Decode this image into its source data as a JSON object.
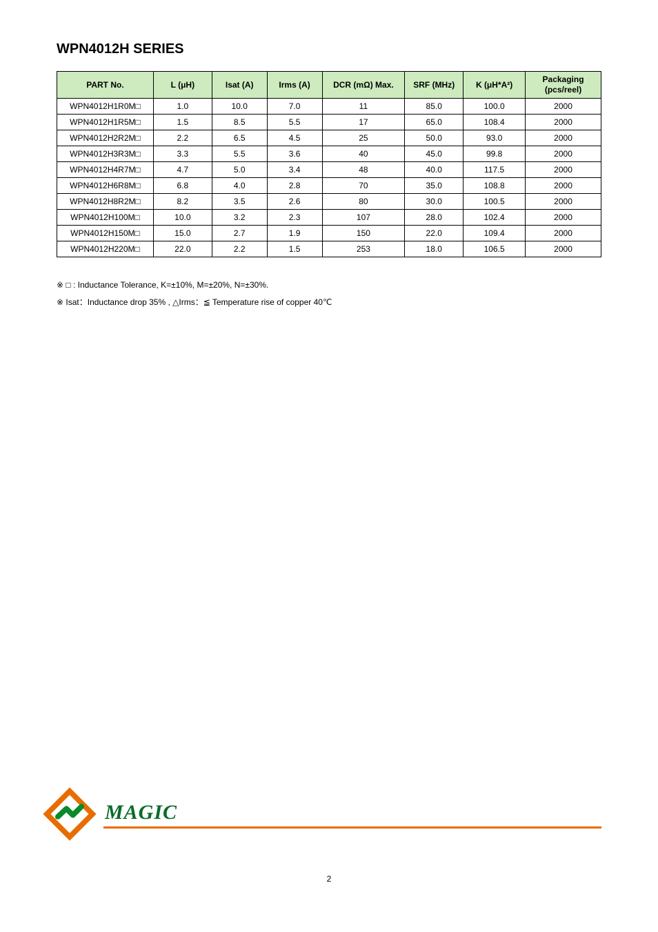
{
  "title": "WPN4012H SERIES",
  "columns": {
    "part": "PART No.",
    "l": "L (μH)",
    "isat": "Isat (A)",
    "irms": "Irms (A)",
    "dcr": "DCR (mΩ) Max.",
    "srf": "SRF (MHz)",
    "k": "K (μH*A²)",
    "pack": "Packaging (pcs/reel)"
  },
  "rows": [
    {
      "part": "WPN4012H1R0M□",
      "l": "1.0",
      "isat": "10.0",
      "irms": "7.0",
      "dcr": "11",
      "srf": "85.0",
      "k": "100.0",
      "pack": "2000"
    },
    {
      "part": "WPN4012H1R5M□",
      "l": "1.5",
      "isat": "8.5",
      "irms": "5.5",
      "dcr": "17",
      "srf": "65.0",
      "k": "108.4",
      "pack": "2000"
    },
    {
      "part": "WPN4012H2R2M□",
      "l": "2.2",
      "isat": "6.5",
      "irms": "4.5",
      "dcr": "25",
      "srf": "50.0",
      "k": "93.0",
      "pack": "2000"
    },
    {
      "part": "WPN4012H3R3M□",
      "l": "3.3",
      "isat": "5.5",
      "irms": "3.6",
      "dcr": "40",
      "srf": "45.0",
      "k": "99.8",
      "pack": "2000"
    },
    {
      "part": "WPN4012H4R7M□",
      "l": "4.7",
      "isat": "5.0",
      "irms": "3.4",
      "dcr": "48",
      "srf": "40.0",
      "k": "117.5",
      "pack": "2000"
    },
    {
      "part": "WPN4012H6R8M□",
      "l": "6.8",
      "isat": "4.0",
      "irms": "2.8",
      "dcr": "70",
      "srf": "35.0",
      "k": "108.8",
      "pack": "2000"
    },
    {
      "part": "WPN4012H8R2M□",
      "l": "8.2",
      "isat": "3.5",
      "irms": "2.6",
      "dcr": "80",
      "srf": "30.0",
      "k": "100.5",
      "pack": "2000"
    },
    {
      "part": "WPN4012H100M□",
      "l": "10.0",
      "isat": "3.2",
      "irms": "2.3",
      "dcr": "107",
      "srf": "28.0",
      "k": "102.4",
      "pack": "2000"
    },
    {
      "part": "WPN4012H150M□",
      "l": "15.0",
      "isat": "2.7",
      "irms": "1.9",
      "dcr": "150",
      "srf": "22.0",
      "k": "109.4",
      "pack": "2000"
    },
    {
      "part": "WPN4012H220M□",
      "l": "22.0",
      "isat": "2.2",
      "irms": "1.5",
      "dcr": "253",
      "srf": "18.0",
      "k": "106.5",
      "pack": "2000"
    }
  ],
  "note1": "※ □ : Inductance Tolerance, K=±10%, M=±20%, N=±30%.",
  "note2": "※ Isat：Inductance drop 35% , △Irms：≦ Temperature rise of copper 40℃",
  "brand": "MAGIC",
  "page": "2"
}
